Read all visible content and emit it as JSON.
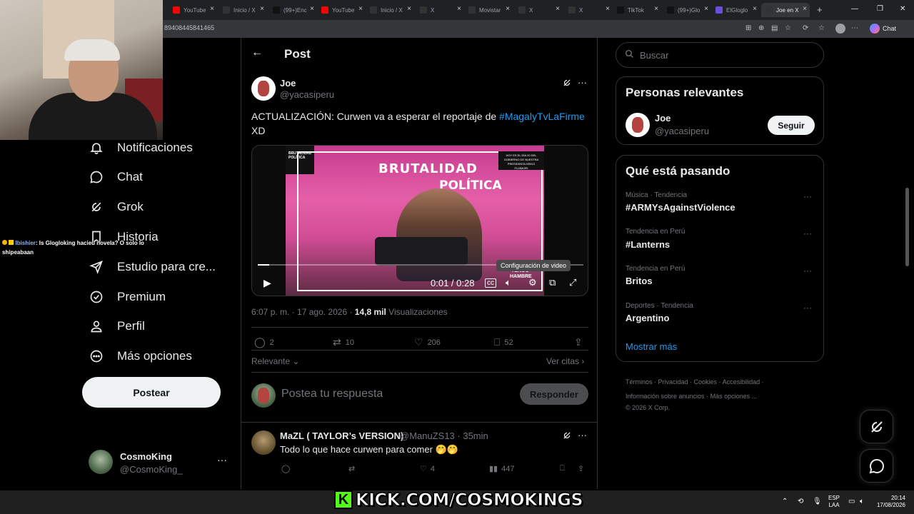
{
  "browser": {
    "tabs": [
      {
        "label": "YouTube",
        "favicon": "youtube",
        "color": "#ff0000"
      },
      {
        "label": "Inicio / X",
        "favicon": "x",
        "color": "#333"
      },
      {
        "label": "(99+)Enc",
        "favicon": "tiktok",
        "color": "#111"
      },
      {
        "label": "YouTube",
        "favicon": "youtube",
        "color": "#ff0000"
      },
      {
        "label": "Inicio / X",
        "favicon": "x",
        "color": "#333"
      },
      {
        "label": "X",
        "favicon": "x",
        "color": "#333"
      },
      {
        "label": "Movistar",
        "favicon": "x",
        "color": "#333"
      },
      {
        "label": "X",
        "favicon": "x",
        "color": "#333"
      },
      {
        "label": "X",
        "favicon": "x",
        "color": "#333"
      },
      {
        "label": "TikTok",
        "favicon": "tiktok",
        "color": "#111"
      },
      {
        "label": "(99+)Glo",
        "favicon": "tiktok",
        "color": "#111"
      },
      {
        "label": "ElGloglo",
        "favicon": "kick",
        "color": "#6b4fd8"
      },
      {
        "label": "Joe en X",
        "favicon": "x",
        "color": "#333",
        "active": true
      }
    ],
    "url": "89408445841465",
    "chat_label": "Chat",
    "new_tab_icon": "plus-icon",
    "window_controls": [
      "—",
      "❐",
      "✕"
    ]
  },
  "overlay_chat": {
    "user": "Ibishier",
    "message": ": Is Glogloking hacieu novela? O solo lo shipeabaan"
  },
  "nav": {
    "items": [
      {
        "label": "Notificaciones",
        "icon": "bell-icon"
      },
      {
        "label": "Chat",
        "icon": "chat-icon"
      },
      {
        "label": "Grok",
        "icon": "grok-icon"
      },
      {
        "label": "Historia",
        "icon": "bookmark-icon"
      },
      {
        "label": "Estudio para cre...",
        "icon": "rocket-icon"
      },
      {
        "label": "Premium",
        "icon": "verified-icon"
      },
      {
        "label": "Perfil",
        "icon": "profile-icon"
      },
      {
        "label": "Más opciones",
        "icon": "more-circle-icon"
      }
    ],
    "post_button": "Postear",
    "account": {
      "name": "CosmoKing",
      "handle": "@CosmoKing_",
      "more": "···"
    }
  },
  "header": {
    "back": "←",
    "title": "Post"
  },
  "tweet": {
    "name": "Joe",
    "handle": "@yacasiperu",
    "text_before": "ACTUALIZACIÓN: Curwen va a esperar el reportaje de ",
    "hashtag": "#MagalyTvLaFirme",
    "text_after": "XD",
    "video": {
      "time": "0:01 / 0:28",
      "progress": 0.036,
      "tooltip": "Configuración de video",
      "overlay_title_1": "BRUTALIDAD",
      "overlay_title_2": "POLÍTICA",
      "side_logo": "BRUTALIDAD POLÍTICA",
      "badge": "HOY ES EL DÍA 20 DEL GOBIERNO DE NUESTRA PRESIDENTA KEIKO FUJIMORI",
      "caption": "TENGO",
      "subcaption": "HAMBRE"
    },
    "time": "6:07 p. m.",
    "date": "17 ago. 2026",
    "views": "14,8 mil",
    "views_label": "Visualizaciones",
    "replies": "2",
    "reposts": "10",
    "likes": "206",
    "bookmarks": "52",
    "sort": "Relevante",
    "see_quotes": "Ver citas ›"
  },
  "reply_box": {
    "placeholder": "Postea tu respuesta",
    "button": "Responder"
  },
  "reply": {
    "name": "MaZL ( TAYLOR’s VERSION)",
    "handle": "@ManuZS13 · 35min",
    "text": "Todo lo que hace curwen para comer 🤭🤭",
    "likes": "4",
    "views": "447"
  },
  "sidebar": {
    "search_placeholder": "Buscar",
    "relevant_title": "Personas relevantes",
    "relevant": {
      "name": "Joe",
      "handle": "@yacasiperu",
      "button": "Seguir"
    },
    "trends_title": "Qué está pasando",
    "trends": [
      {
        "category": "Música · Tendencia",
        "name": "#ARMYsAgainstViolence"
      },
      {
        "category": "Tendencia en Perú",
        "name": "#Lanterns"
      },
      {
        "category": "Tendencia en Perú",
        "name": "Britos"
      },
      {
        "category": "Deportes · Tendencia",
        "name": "Argentino"
      }
    ],
    "show_more": "Mostrar más",
    "footer": [
      "Términos",
      "Privacidad",
      "Cookies",
      "Accesibilidad",
      "Información sobre anuncios",
      "Más opciones ...",
      "© 2026 X Corp."
    ]
  },
  "stream": {
    "kick_logo": "K",
    "kick_text": "KICK.COM/COSMOKINGS"
  },
  "taskbar": {
    "lang_1": "ESP",
    "lang_2": "LAA",
    "time": "20:14",
    "date": "17/08/2026"
  },
  "colors": {
    "accent": "#1d9bf0",
    "kick": "#53fc18",
    "background": "#000000"
  }
}
